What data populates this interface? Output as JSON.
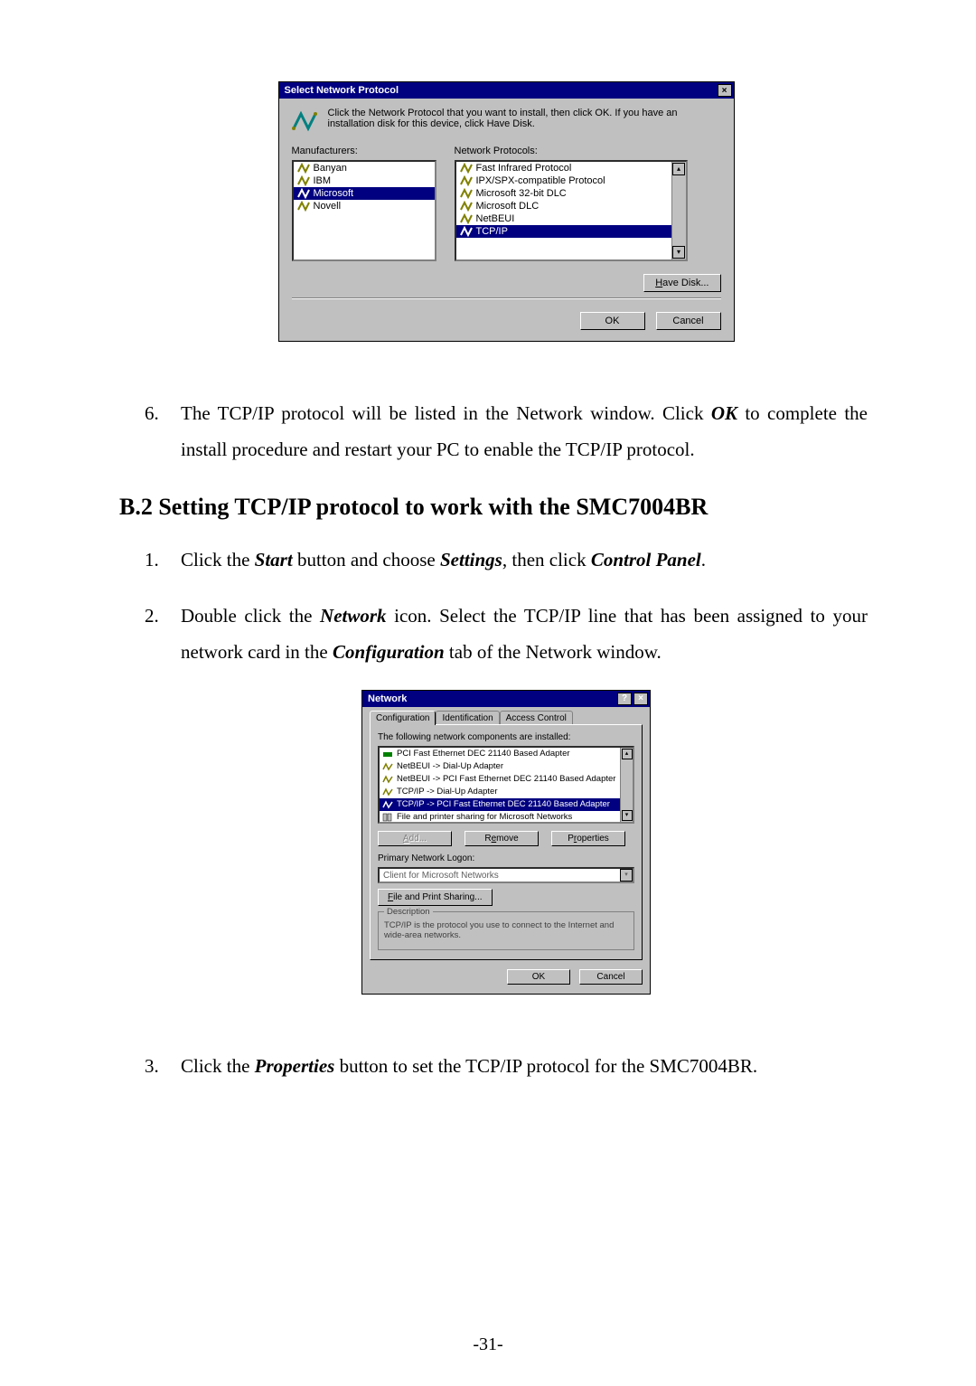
{
  "dialog1": {
    "title": "Select Network Protocol",
    "close": "×",
    "instruction": "Click the Network Protocol that you want to install, then click OK. If you have an installation disk for this device, click Have Disk.",
    "manufacturers_label": "Manufacturers:",
    "protocols_label": "Network Protocols:",
    "manufacturers": [
      "Banyan",
      "IBM",
      "Microsoft",
      "Novell"
    ],
    "manufacturers_selected_index": 2,
    "protocols": [
      "Fast Infrared Protocol",
      "IPX/SPX-compatible Protocol",
      "Microsoft 32-bit DLC",
      "Microsoft DLC",
      "NetBEUI",
      "TCP/IP"
    ],
    "protocols_selected_index": 5,
    "have_disk_label": "Have Disk...",
    "ok_label": "OK",
    "cancel_label": "Cancel"
  },
  "step6": {
    "num": "6.",
    "a": "The TCP/IP protocol will be listed in the Network window. Click ",
    "b": "OK",
    "c": " to complete the install procedure and restart your PC to enable the TCP/IP protocol."
  },
  "heading": "B.2 Setting TCP/IP protocol to work with the SMC7004BR",
  "step1": {
    "num": "1.",
    "a": "Click the ",
    "b": "Start",
    "c": " button and choose ",
    "d": "Settings",
    "e": ", then click ",
    "f": "Control Panel",
    "g": "."
  },
  "step2": {
    "num": "2.",
    "a": "Double click the ",
    "b": "Network",
    "c": " icon. Select the TCP/IP line that has been assigned to your network card in the ",
    "d": "Configuration",
    "e": " tab of the Network window."
  },
  "dialog2": {
    "title": "Network",
    "help": "?",
    "close": "×",
    "tabs": [
      "Configuration",
      "Identification",
      "Access Control"
    ],
    "active_tab_index": 0,
    "components_caption": "The following network components are installed:",
    "components": [
      "PCI Fast Ethernet DEC 21140 Based Adapter",
      "NetBEUI -> Dial-Up Adapter",
      "NetBEUI -> PCI Fast Ethernet DEC 21140 Based Adapter",
      "TCP/IP -> Dial-Up Adapter",
      "TCP/IP -> PCI Fast Ethernet DEC 21140 Based Adapter",
      "File and printer sharing for Microsoft Networks"
    ],
    "components_selected_index": 4,
    "add_label": "Add...",
    "remove_label": "Remove",
    "properties_label": "Properties",
    "logon_label": "Primary Network Logon:",
    "logon_value": "Client for Microsoft Networks",
    "fps_label": "File and Print Sharing...",
    "desc_title": "Description",
    "desc_text": "TCP/IP is the protocol you use to connect to the Internet and wide-area networks.",
    "ok_label": "OK",
    "cancel_label": "Cancel"
  },
  "step3": {
    "num": "3.",
    "a": "Click the ",
    "b": "Properties",
    "c": " button to set the TCP/IP protocol for the SMC7004BR."
  },
  "page_number": "-31-"
}
